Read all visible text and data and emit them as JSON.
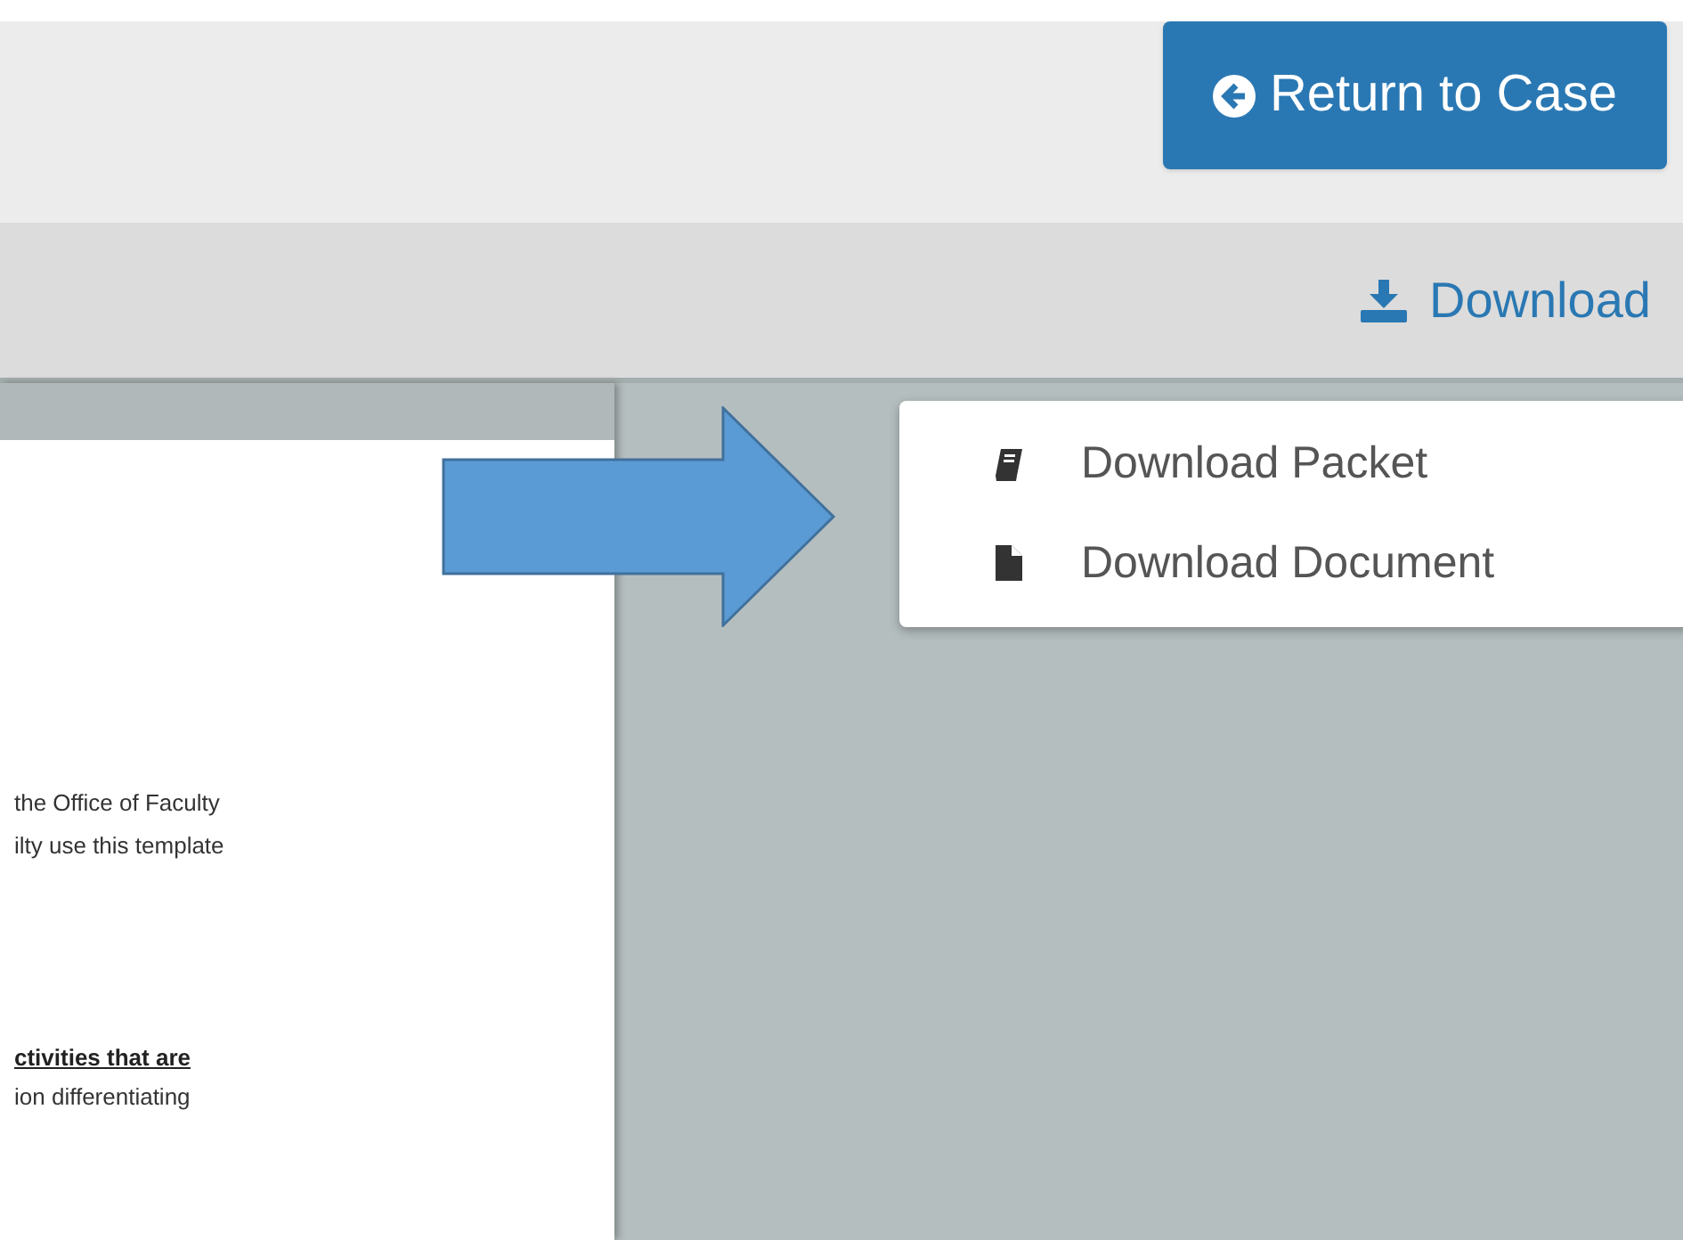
{
  "header": {
    "return_button": {
      "label": "Return to Case"
    }
  },
  "toolbar": {
    "download_button": {
      "label": "Download",
      "expanded": true
    }
  },
  "download_menu": [
    {
      "label": "Download Packet",
      "kind": "packet"
    },
    {
      "label": "Download Document",
      "kind": "document"
    }
  ],
  "document": {
    "lines": [
      {
        "text": "the Office of Faculty",
        "kind": "plain"
      },
      {
        "text": "ilty use this template",
        "kind": "plain"
      },
      {
        "text": "ctivities that are",
        "kind": "heading"
      },
      {
        "text": "ion differentiating",
        "kind": "plain"
      }
    ]
  }
}
